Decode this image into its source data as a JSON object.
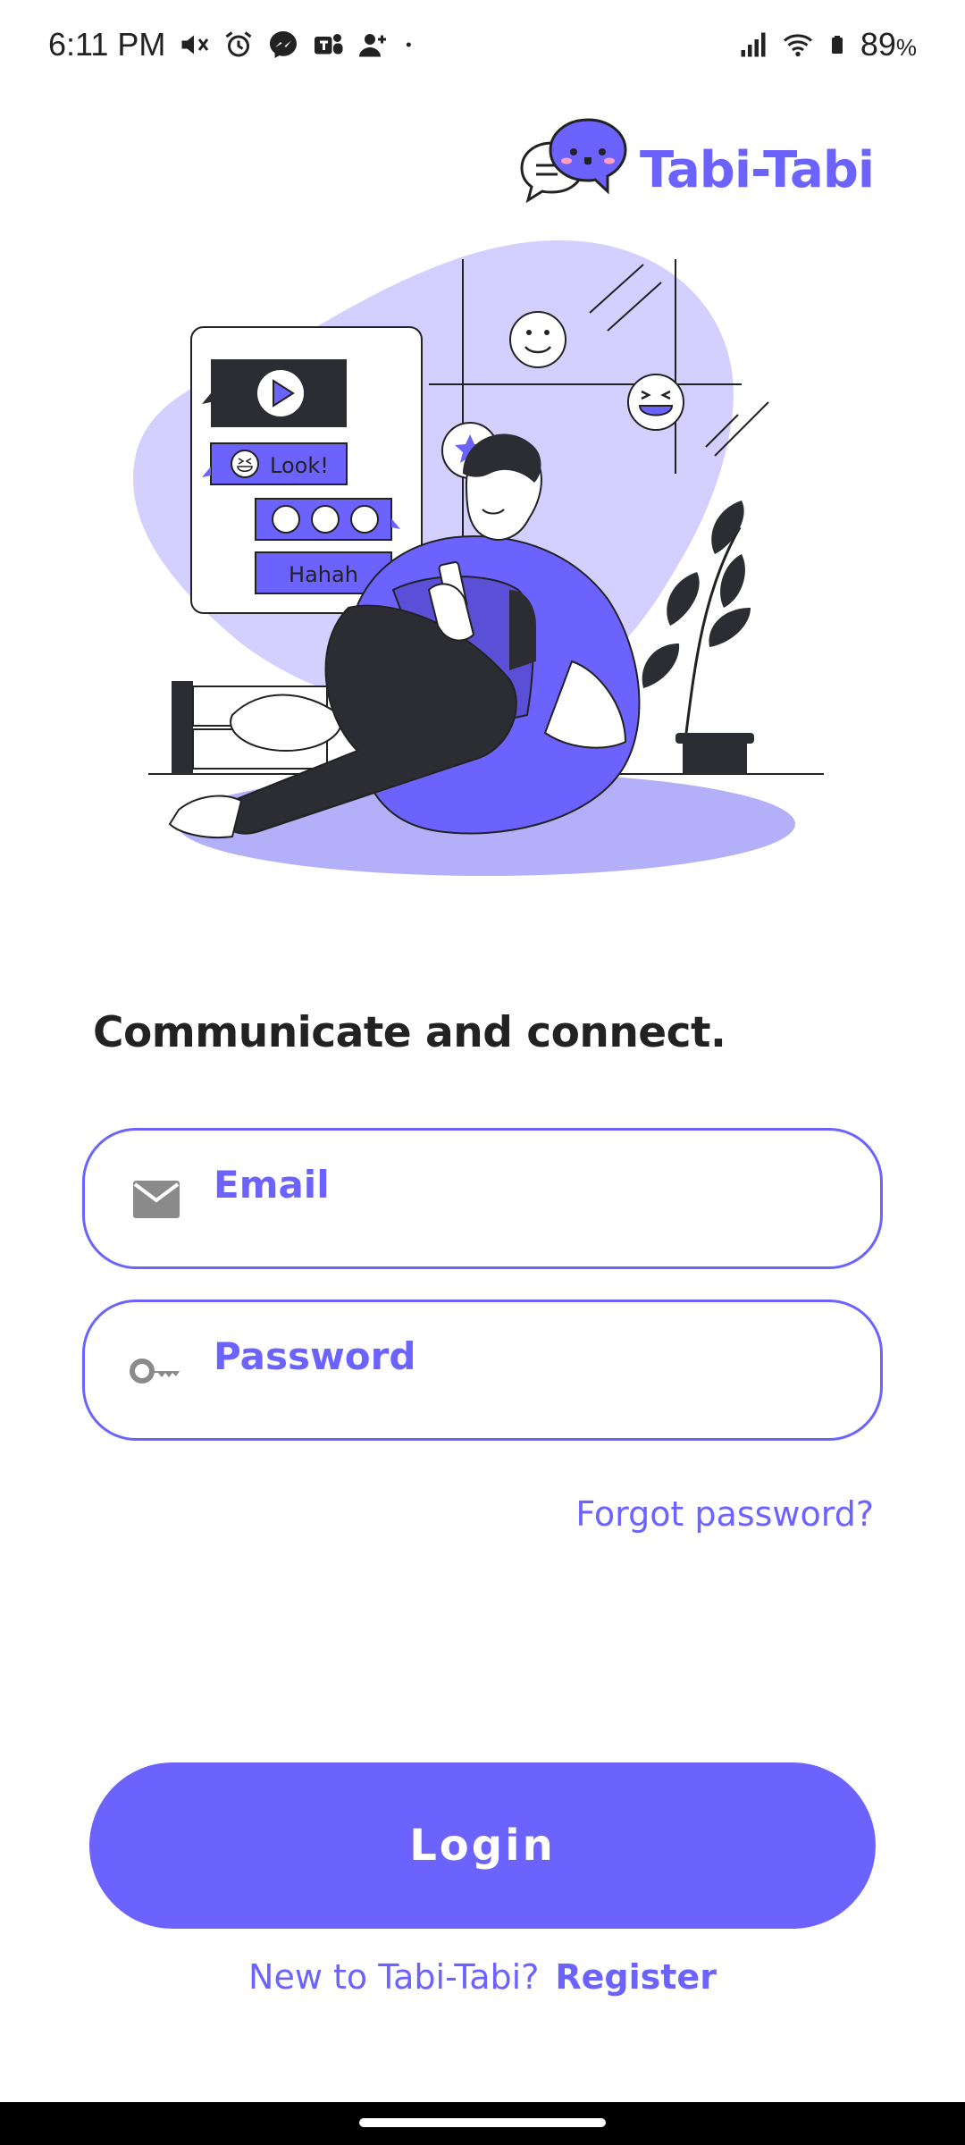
{
  "status_bar": {
    "time": "6:11 PM",
    "battery": "89",
    "battery_unit": "%",
    "icons_left": [
      "mute-vibrate-icon",
      "alarm-icon",
      "messenger-icon",
      "teams-icon",
      "person-add-icon",
      "dot-icon"
    ],
    "icons_right": [
      "signal-icon",
      "wifi-icon",
      "battery-icon"
    ]
  },
  "app": {
    "name": "Tabi-Tabi",
    "brand_color": "#6c63ff"
  },
  "illustration": {
    "bubble_look": "Look!",
    "bubble_hahah": "Hahah"
  },
  "login": {
    "tagline": "Communicate and connect.",
    "email_placeholder": "Email",
    "password_placeholder": "Password",
    "forgot": "Forgot password?",
    "button": "Login",
    "new_prompt": "New to Tabi-Tabi?",
    "register": "Register"
  }
}
